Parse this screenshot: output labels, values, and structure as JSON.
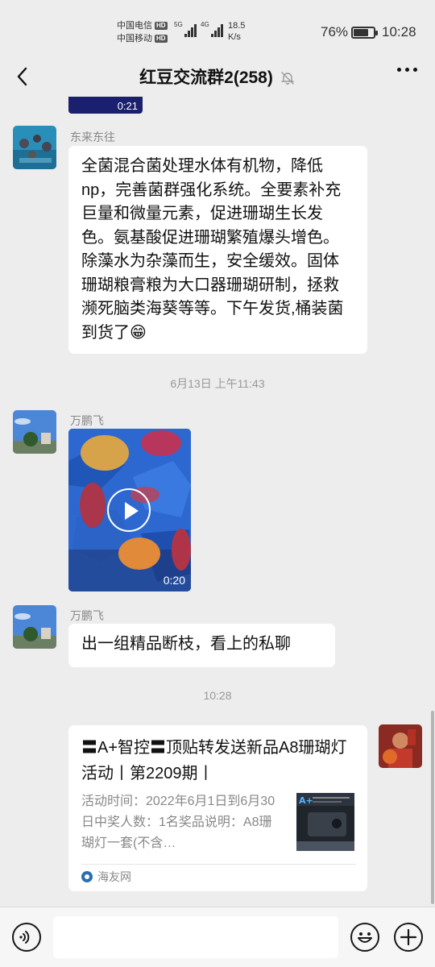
{
  "status_bar": {
    "carrier_1": "中国电信",
    "carrier_2": "中国移动",
    "hd": "HD",
    "net_1": "5G",
    "net_2": "4G",
    "speed_value": "18.5",
    "speed_unit": "K/s",
    "battery_percent": "76%",
    "battery_level": 0.76,
    "time": "10:28"
  },
  "header": {
    "title": "红豆交流群2(258)",
    "back_icon": "chevron-left-icon",
    "mute_icon": "bell-off-icon",
    "more_icon": "more-icon"
  },
  "chat": {
    "previous_video_duration": "0:21",
    "messages": [
      {
        "sender": "东来东往",
        "text": "全菌混合菌处理水体有机物，降低np，完善菌群强化系统。全要素补充巨量和微量元素，促进珊瑚生长发色。氨基酸促进珊瑚繁殖爆头增色。除藻水为杂藻而生，安全缓效。固体珊瑚粮膏粮为大口器珊瑚研制，拯救濒死脑类海葵等等。下午发货,桶装菌到货了😁"
      },
      {
        "timestamp": "6月13日 上午11:43"
      },
      {
        "sender": "万鹏飞",
        "video_duration": "0:20"
      },
      {
        "sender": "万鹏飞",
        "text": "出一组精品断枝，看上的私聊"
      },
      {
        "timestamp": "10:28"
      },
      {
        "card_title": "〓A+智控〓顶贴转发送新品A8珊瑚灯活动丨第2209期丨",
        "card_desc": "活动时间：2022年6月1日到6月30日中奖人数：1名奖品说明：A8珊瑚灯一套(不含…",
        "card_source": "海友网"
      }
    ]
  },
  "input_bar": {
    "voice_icon": "voice-icon",
    "emoji_icon": "emoji-icon",
    "plus_icon": "plus-icon"
  }
}
